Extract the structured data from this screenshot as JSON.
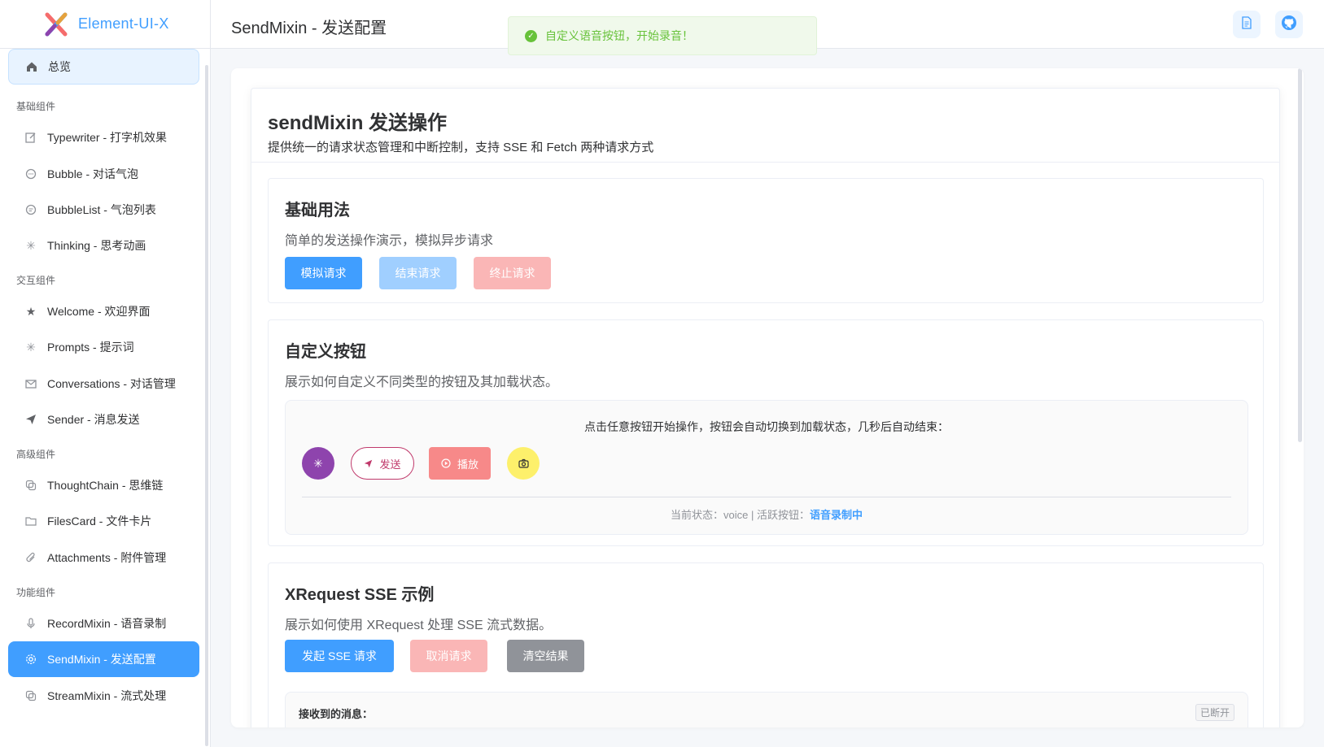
{
  "app": {
    "logo_text": "Element-UI-X"
  },
  "sidebar": {
    "home": "总览",
    "groups": {
      "basic": "基础组件",
      "interactive": "交互组件",
      "advanced": "高级组件",
      "function": "功能组件"
    },
    "items": [
      {
        "label": "Typewriter - 打字机效果",
        "icon": "edit-icon"
      },
      {
        "label": "Bubble - 对话气泡",
        "icon": "chat-bubble-icon"
      },
      {
        "label": "BubbleList - 气泡列表",
        "icon": "chat-list-icon"
      },
      {
        "label": "Thinking - 思考动画",
        "icon": "loading-icon"
      },
      {
        "label": "Welcome - 欢迎界面",
        "icon": "star-icon"
      },
      {
        "label": "Prompts - 提示词",
        "icon": "loading-icon"
      },
      {
        "label": "Conversations - 对话管理",
        "icon": "mail-icon"
      },
      {
        "label": "Sender - 消息发送",
        "icon": "send-icon"
      },
      {
        "label": "ThoughtChain - 思维链",
        "icon": "copy-icon"
      },
      {
        "label": "FilesCard - 文件卡片",
        "icon": "folder-icon"
      },
      {
        "label": "Attachments - 附件管理",
        "icon": "paperclip-icon"
      },
      {
        "label": "RecordMixin - 语音录制",
        "icon": "microphone-icon"
      },
      {
        "label": "SendMixin - 发送配置",
        "icon": "gear-icon"
      },
      {
        "label": "StreamMixin - 流式处理",
        "icon": "copy-icon"
      }
    ]
  },
  "header": {
    "title": "SendMixin - 发送配置",
    "doc_icon": "document-icon",
    "github_icon": "github-icon"
  },
  "toast": {
    "message": "自定义语音按钮，开始录音！",
    "color": "#67c23a"
  },
  "card": {
    "title": "sendMixin 发送操作",
    "subtitle": "提供统一的请求状态管理和中断控制，支持 SSE 和 Fetch 两种请求方式"
  },
  "basic": {
    "title": "基础用法",
    "desc": "简单的发送操作演示，模拟异步请求",
    "btn_simulate": "模拟请求",
    "btn_finish": "结束请求",
    "btn_abort": "终止请求"
  },
  "custom": {
    "title": "自定义按钮",
    "desc": "展示如何自定义不同类型的按钮及其加载状态。",
    "hint": "点击任意按钮开始操作，按钮会自动切换到加载状态，几秒后自动结束：",
    "btn_send": "发送",
    "btn_play": "播放",
    "status_prefix": "当前状态：voice | 活跃按钮：",
    "status_active": "语音录制中"
  },
  "xrequest": {
    "title": "XRequest SSE 示例",
    "desc": "展示如何使用 XRequest 处理 SSE 流式数据。",
    "btn_start": "发起 SSE 请求",
    "btn_cancel": "取消请求",
    "btn_clear": "清空结果",
    "recv_label": "接收到的消息：",
    "recv_status": "已断开"
  },
  "colors": {
    "primary": "#409eff",
    "success": "#67c23a",
    "purple": "#8e44ad",
    "play_red": "#f56c6c",
    "camera_yellow": "#fdf06b"
  }
}
